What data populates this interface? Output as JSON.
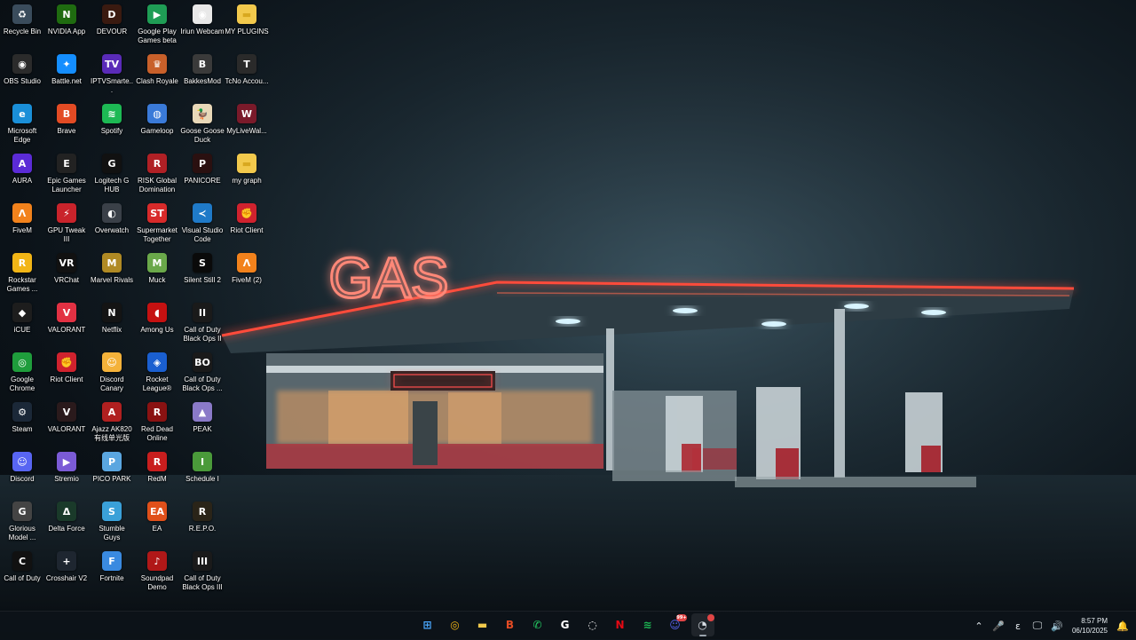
{
  "desktop": {
    "columns": [
      [
        {
          "label": "Recycle Bin",
          "icon": "recycle-bin-icon",
          "color": "#3a4c5c"
        },
        {
          "label": "OBS Studio",
          "icon": "obs-icon",
          "color": "#2b2b2b"
        },
        {
          "label": "Microsoft Edge",
          "icon": "edge-icon",
          "color": "#1a8fd8"
        },
        {
          "label": "AURA",
          "icon": "aura-icon",
          "color": "#5b2bd6"
        },
        {
          "label": "FiveM",
          "icon": "fivem-icon",
          "color": "#f2821c"
        },
        {
          "label": "Rockstar Games ...",
          "icon": "rockstar-icon",
          "color": "#f2b516"
        },
        {
          "label": "iCUE",
          "icon": "icue-icon",
          "color": "#1d1d1d"
        },
        {
          "label": "Google Chrome",
          "icon": "chrome-icon",
          "color": "#1f9d3c"
        },
        {
          "label": "Steam",
          "icon": "steam-icon",
          "color": "#1b2838"
        },
        {
          "label": "Discord",
          "icon": "discord-icon",
          "color": "#5865f2"
        },
        {
          "label": "Glorious Model ...",
          "icon": "glorious-icon",
          "color": "#444444"
        },
        {
          "label": "Call of Duty",
          "icon": "cod-icon",
          "color": "#111111"
        }
      ],
      [
        {
          "label": "NVIDIA App",
          "icon": "nvidia-icon",
          "color": "#1f6b10"
        },
        {
          "label": "Battle.net",
          "icon": "battlenet-icon",
          "color": "#148eff"
        },
        {
          "label": "Brave",
          "icon": "brave-icon",
          "color": "#e34b24"
        },
        {
          "label": "Epic Games Launcher",
          "icon": "epic-icon",
          "color": "#222222"
        },
        {
          "label": "GPU Tweak III",
          "icon": "gpu-tweak-icon",
          "color": "#c9232b"
        },
        {
          "label": "VRChat",
          "icon": "vrchat-icon",
          "color": "#111111"
        },
        {
          "label": "VALORANT",
          "icon": "valorant-icon",
          "color": "#e23143"
        },
        {
          "label": "Riot Client",
          "icon": "riot-client-icon",
          "color": "#d0222e"
        },
        {
          "label": "VALORANT",
          "icon": "valorant-icon",
          "color": "#2a1a1c"
        },
        {
          "label": "Stremio",
          "icon": "stremio-icon",
          "color": "#7b5bd6"
        },
        {
          "label": "Delta Force",
          "icon": "delta-force-icon",
          "color": "#1a3a2a"
        },
        {
          "label": "Crosshair V2",
          "icon": "crosshair-icon",
          "color": "#1e2630"
        }
      ],
      [
        {
          "label": "DEVOUR",
          "icon": "devour-icon",
          "color": "#3a1a10"
        },
        {
          "label": "IPTVSmarte...",
          "icon": "iptv-icon",
          "color": "#5a2bb8"
        },
        {
          "label": "Spotify",
          "icon": "spotify-icon",
          "color": "#1db954"
        },
        {
          "label": "Logitech G HUB",
          "icon": "logitech-icon",
          "color": "#111111"
        },
        {
          "label": "Overwatch",
          "icon": "overwatch-icon",
          "color": "#3a4048"
        },
        {
          "label": "Marvel Rivals",
          "icon": "marvel-rivals-icon",
          "color": "#b08a24"
        },
        {
          "label": "Netflix",
          "icon": "netflix-icon",
          "color": "#141414"
        },
        {
          "label": "Discord Canary",
          "icon": "discord-canary-icon",
          "color": "#f4b23a"
        },
        {
          "label": "Ajazz AK820 有线单光版",
          "icon": "ajazz-icon",
          "color": "#b02020"
        },
        {
          "label": "PICO PARK",
          "icon": "pico-park-icon",
          "color": "#5aa6e0"
        },
        {
          "label": "Stumble Guys",
          "icon": "stumble-guys-icon",
          "color": "#3aa0d8"
        },
        {
          "label": "Fortnite",
          "icon": "fortnite-icon",
          "color": "#3a8ae0"
        }
      ],
      [
        {
          "label": "Google Play Games beta",
          "icon": "play-games-icon",
          "color": "#1f9d55"
        },
        {
          "label": "Clash Royale",
          "icon": "clash-royale-icon",
          "color": "#c8602a"
        },
        {
          "label": "Gameloop",
          "icon": "gameloop-icon",
          "color": "#3a7ad8"
        },
        {
          "label": "RISK Global Domination",
          "icon": "risk-icon",
          "color": "#b02025"
        },
        {
          "label": "Supermarket Together",
          "icon": "supermarket-icon",
          "color": "#d82a2a"
        },
        {
          "label": "Muck",
          "icon": "muck-icon",
          "color": "#6aa84a"
        },
        {
          "label": "Among Us",
          "icon": "among-us-icon",
          "color": "#c51111"
        },
        {
          "label": "Rocket League®",
          "icon": "rocket-league-icon",
          "color": "#1a5fd0"
        },
        {
          "label": "Red Dead Online",
          "icon": "rdo-icon",
          "color": "#8a1212"
        },
        {
          "label": "RedM",
          "icon": "redm-icon",
          "color": "#c81e1e"
        },
        {
          "label": "EA",
          "icon": "ea-icon",
          "color": "#e0501a"
        },
        {
          "label": "Soundpad Demo",
          "icon": "soundpad-icon",
          "color": "#b01818"
        }
      ],
      [
        {
          "label": "Iriun Webcam",
          "icon": "iriun-icon",
          "color": "#e8e8e8"
        },
        {
          "label": "BakkesMod",
          "icon": "bakkesmod-icon",
          "color": "#3a3a3a"
        },
        {
          "label": "Goose Goose Duck",
          "icon": "goose-duck-icon",
          "color": "#e8d8b8"
        },
        {
          "label": "PANICORE",
          "icon": "panicore-icon",
          "color": "#2a1010"
        },
        {
          "label": "Visual Studio Code",
          "icon": "vscode-icon",
          "color": "#1f7ac8"
        },
        {
          "label": "Silent Still 2",
          "icon": "silent-still-icon",
          "color": "#0a0a0a"
        },
        {
          "label": "Call of Duty Black Ops II",
          "icon": "bo2-icon",
          "color": "#1a1a1a"
        },
        {
          "label": "Call of Duty Black Ops ...",
          "icon": "bo-icon",
          "color": "#1a1a1a"
        },
        {
          "label": "PEAK",
          "icon": "peak-icon",
          "color": "#8a7ac8"
        },
        {
          "label": "Schedule I",
          "icon": "schedule-icon",
          "color": "#4a9a3a"
        },
        {
          "label": "R.E.P.O.",
          "icon": "repo-icon",
          "color": "#2a2418"
        },
        {
          "label": "Call of Duty Black Ops III",
          "icon": "bo3-icon",
          "color": "#1a1a1a"
        }
      ],
      [
        {
          "label": "MY PLUGINS",
          "icon": "folder-icon",
          "color": "#f2c94c"
        },
        {
          "label": "TcNo Accou...",
          "icon": "tcno-icon",
          "color": "#2a2a2a"
        },
        {
          "label": "MyLiveWal...",
          "icon": "mylivewallpaper-icon",
          "color": "#7a1a2a"
        },
        {
          "label": "my graph",
          "icon": "folder-icon",
          "color": "#f2c94c"
        },
        {
          "label": "Riot Client",
          "icon": "riot-client-icon",
          "color": "#d0222e"
        },
        {
          "label": "FiveM (2)",
          "icon": "fivem-icon",
          "color": "#f2821c"
        }
      ]
    ],
    "glyphs": {
      "recycle-bin-icon": "♻",
      "obs-icon": "◉",
      "edge-icon": "e",
      "aura-icon": "A",
      "fivem-icon": "Λ",
      "rockstar-icon": "R",
      "icue-icon": "◆",
      "chrome-icon": "◎",
      "steam-icon": "⚙",
      "discord-icon": "☺",
      "glorious-icon": "G",
      "cod-icon": "C",
      "nvidia-icon": "N",
      "battlenet-icon": "✦",
      "brave-icon": "B",
      "epic-icon": "E",
      "gpu-tweak-icon": "⚡",
      "vrchat-icon": "VR",
      "valorant-icon": "V",
      "riot-client-icon": "✊",
      "stremio-icon": "▶",
      "delta-force-icon": "Δ",
      "crosshair-icon": "+",
      "devour-icon": "D",
      "iptv-icon": "TV",
      "spotify-icon": "≋",
      "logitech-icon": "G",
      "overwatch-icon": "◐",
      "marvel-rivals-icon": "M",
      "netflix-icon": "N",
      "discord-canary-icon": "☺",
      "ajazz-icon": "A",
      "pico-park-icon": "P",
      "stumble-guys-icon": "S",
      "fortnite-icon": "F",
      "play-games-icon": "▶",
      "clash-royale-icon": "♛",
      "gameloop-icon": "◍",
      "risk-icon": "R",
      "supermarket-icon": "ST",
      "muck-icon": "M",
      "among-us-icon": "◖",
      "rocket-league-icon": "◈",
      "rdo-icon": "R",
      "redm-icon": "R",
      "ea-icon": "EA",
      "soundpad-icon": "♪",
      "iriun-icon": "◉",
      "bakkesmod-icon": "B",
      "goose-duck-icon": "🦆",
      "panicore-icon": "P",
      "vscode-icon": "≺",
      "silent-still-icon": "S",
      "bo2-icon": "II",
      "bo-icon": "BO",
      "peak-icon": "▲",
      "schedule-icon": "I",
      "repo-icon": "R",
      "bo3-icon": "III",
      "folder-icon": "▬",
      "tcno-icon": "T",
      "mylivewallpaper-icon": "W"
    }
  },
  "taskbar": {
    "apps": [
      {
        "name": "start-button",
        "glyph": "⊞",
        "color": "#4aa8ff",
        "active": false
      },
      {
        "name": "taskbar-chrome",
        "glyph": "◎",
        "color": "#f2b516",
        "active": false
      },
      {
        "name": "taskbar-file-explorer",
        "glyph": "▬",
        "color": "#f2c94c",
        "active": false
      },
      {
        "name": "taskbar-brave",
        "glyph": "B",
        "color": "#e34b24",
        "active": false
      },
      {
        "name": "taskbar-whatsapp",
        "glyph": "✆",
        "color": "#25d366",
        "active": false
      },
      {
        "name": "taskbar-logitech",
        "glyph": "G",
        "color": "#ffffff",
        "active": false
      },
      {
        "name": "taskbar-crosshair",
        "glyph": "◌",
        "color": "#ffffff",
        "active": false
      },
      {
        "name": "taskbar-netflix",
        "glyph": "N",
        "color": "#e50914",
        "active": false
      },
      {
        "name": "taskbar-spotify",
        "glyph": "≋",
        "color": "#1db954",
        "active": false
      },
      {
        "name": "taskbar-discord",
        "glyph": "☺",
        "color": "#5865f2",
        "active": false,
        "badge": "99+"
      },
      {
        "name": "taskbar-app-active",
        "glyph": "◔",
        "color": "#d8dee4",
        "active": true,
        "badge": ""
      }
    ],
    "tray": {
      "chevron": "⌃",
      "mic": "🎤",
      "keyboard": "ε",
      "network": "🖵",
      "volume": "🔊",
      "notifications": "🔔"
    },
    "clock": {
      "time": "8:57 PM",
      "date": "06/10/2025"
    }
  },
  "wallpaper": {
    "sign_text": "GAS"
  }
}
